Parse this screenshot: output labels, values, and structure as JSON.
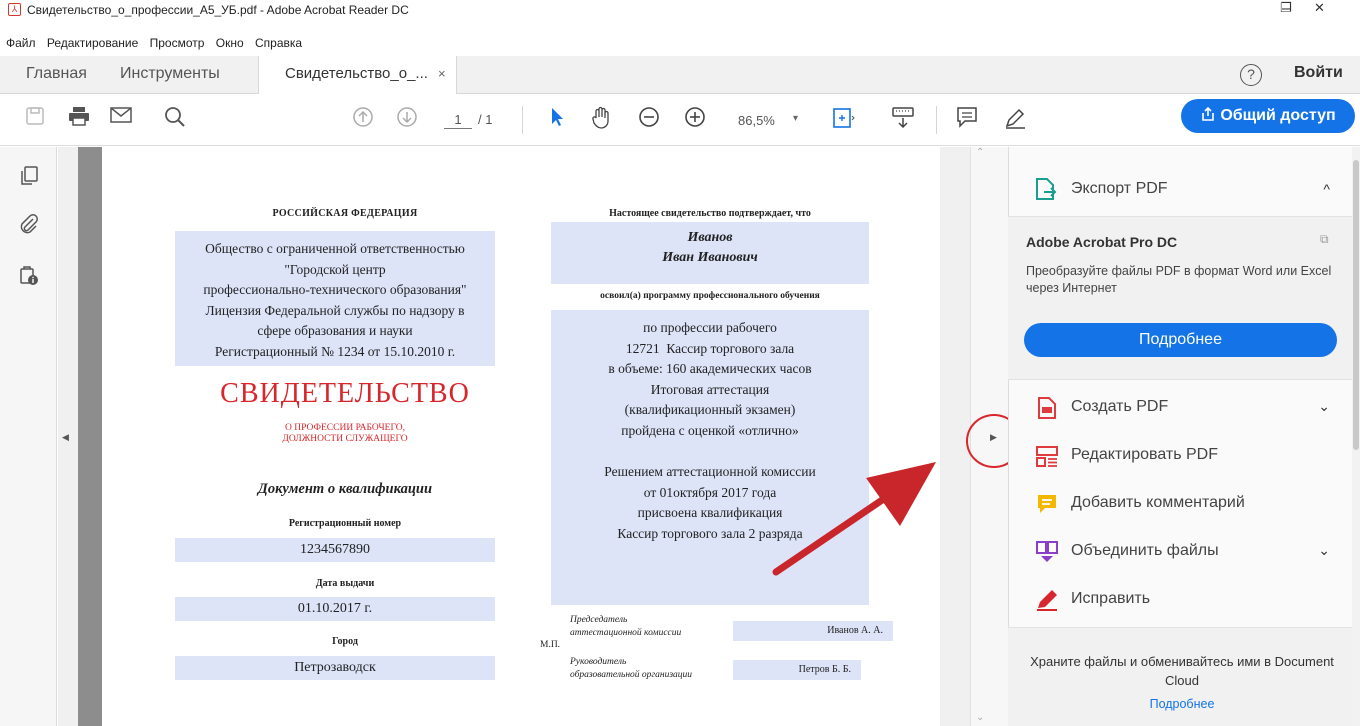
{
  "window": {
    "title": "Свидетельство_о_профессии_А5_УБ.pdf - Adobe Acrobat Reader DC",
    "minimize": "–",
    "restore": "❐",
    "close": "✕"
  },
  "menu": [
    "Файл",
    "Редактирование",
    "Просмотр",
    "Окно",
    "Справка"
  ],
  "tabs": {
    "home": "Главная",
    "tools": "Инструменты",
    "document": "Свидетельство_о_...",
    "close": "×",
    "help": "?",
    "signin": "Войти"
  },
  "toolbar": {
    "page_current": "1",
    "page_total": "/ 1",
    "zoom": "86,5%",
    "zoom_caret": "▾",
    "share": "Общий доступ"
  },
  "document": {
    "left": {
      "country": "РОССИЙСКАЯ ФЕДЕРАЦИЯ",
      "org_lines": [
        "Общество с ограниченной ответственностью",
        "\"Городской центр",
        "профессионально-технического образования\"",
        "Лицензия Федеральной службы по надзору в",
        "сфере образования и науки",
        "Регистрационный № 1234 от 15.10.2010 г."
      ],
      "heading": "СВИДЕТЕЛЬСТВО",
      "subheading_1": "О ПРОФЕССИИ РАБОЧЕГО,",
      "subheading_2": "ДОЛЖНОСТИ СЛУЖАЩЕГО",
      "doc_type": "Документ о квалификации",
      "reg_label": "Регистрационный номер",
      "reg_value": "1234567890",
      "date_label": "Дата выдачи",
      "date_value": "01.10.2017 г.",
      "city_label": "Город",
      "city_value": "Петрозаводск"
    },
    "right": {
      "confirms": "Настоящее свидетельство подтверждает, что",
      "surname": "Иванов",
      "name": "Иван Иванович",
      "mastered": "освоил(а) программу профессионального обучения",
      "body_lines": [
        "по профессии рабочего",
        "12721  Кассир торгового зала",
        "в объеме: 160 академических часов",
        "Итоговая аттестация",
        "(квалификационный экзамен)",
        "пройдена с оценкой «отлично»",
        "",
        "Решением аттестационной комиссии",
        "от 01октября 2017 года",
        "присвоена квалификация",
        "Кассир торгового зала 2 разряда"
      ],
      "chair_label_1": "Председатель",
      "chair_label_2": "аттестационной комиссии",
      "chair_name": "Иванов А. А.",
      "stamp": "М.П.",
      "head_label_1": "Руководитель",
      "head_label_2": "образовательной организации",
      "head_name": "Петров Б. Б."
    }
  },
  "right_panel": {
    "export_title": "Экспорт PDF",
    "export_chevron": "^",
    "pro_title": "Adobe Acrobat Pro DC",
    "pro_desc": "Преобразуйте файлы PDF в формат Word или Excel через Интернет",
    "pro_button": "Подробнее",
    "tools": [
      {
        "label": "Создать PDF",
        "chevron": "⌄",
        "color": "#e0393e"
      },
      {
        "label": "Редактировать PDF",
        "chevron": "",
        "color": "#e0393e"
      },
      {
        "label": "Добавить комментарий",
        "chevron": "",
        "color": "#f5b800"
      },
      {
        "label": "Объединить файлы",
        "chevron": "⌄",
        "color": "#8b3ec7"
      },
      {
        "label": "Исправить",
        "chevron": "",
        "color": "#d7262e"
      }
    ],
    "cloud_text": "Храните файлы и обменивайтесь ими в Document Cloud",
    "cloud_link": "Подробнее"
  },
  "colors": {
    "accent": "#1473e6",
    "annotation": "#d9262b",
    "field_bg": "#dde4f8"
  }
}
